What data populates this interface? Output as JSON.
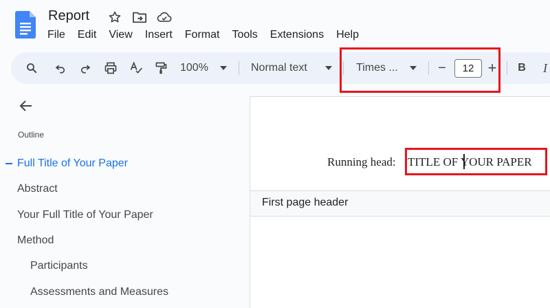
{
  "document": {
    "title": "Report"
  },
  "menu": [
    "File",
    "Edit",
    "View",
    "Insert",
    "Format",
    "Tools",
    "Extensions",
    "Help"
  ],
  "toolbar": {
    "zoom": "100%",
    "style": "Normal text",
    "font": "Times ...",
    "font_size": "12",
    "minus": "−",
    "plus": "+",
    "bold": "B",
    "italic": "I"
  },
  "sidebar": {
    "outline_label": "Outline",
    "items": [
      {
        "label": "Full Title of Your Paper",
        "active": true
      },
      {
        "label": "Abstract"
      },
      {
        "label": "Your Full Title of Your Paper"
      },
      {
        "label": "Method"
      },
      {
        "label": "Participants"
      },
      {
        "label": "Assessments and Measures"
      }
    ]
  },
  "page": {
    "running_head_prefix": "Running head:",
    "running_head_before_cursor": "TITLE OF",
    "running_head_after_cursor": "YOUR PAPER",
    "header_label": "First page header"
  },
  "colors": {
    "accent": "#1a73e8",
    "highlight": "#e8141b",
    "toolbar_bg": "#edf2fa"
  }
}
